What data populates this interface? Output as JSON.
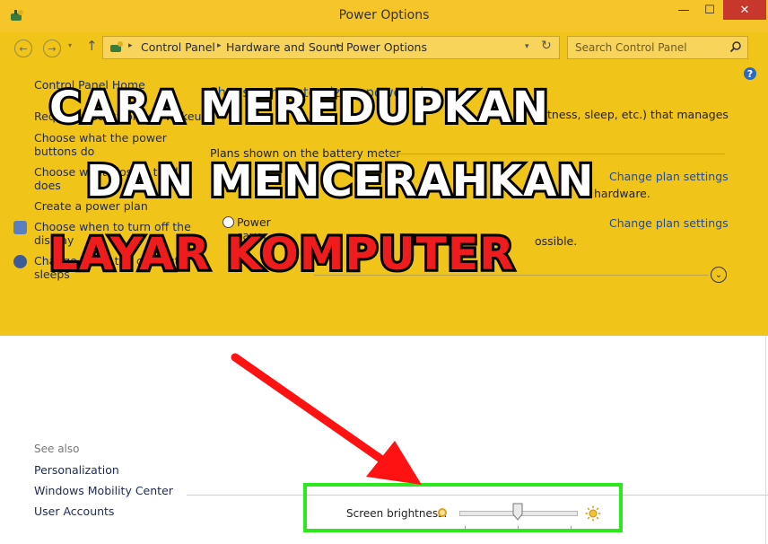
{
  "window": {
    "title": "Power Options",
    "controls": {
      "minimize": "—",
      "maximize": "☐",
      "close": "✕"
    }
  },
  "toolbar": {
    "back_glyph": "←",
    "forward_glyph": "→",
    "recent_glyph": "▾",
    "up_glyph": "↑",
    "breadcrumbs": [
      "Control Panel",
      "Hardware and Sound",
      "Power Options"
    ],
    "separator": "▸",
    "dropdown_glyph": "▾",
    "refresh_glyph": "↻",
    "search_placeholder": "Search Control Panel",
    "help_glyph": "?"
  },
  "sidebar": {
    "items": [
      {
        "label": "Control Panel Home"
      },
      {
        "label": "Require a password on wakeup"
      },
      {
        "label": "Choose what the power"
      },
      {
        "label": "buttons do"
      },
      {
        "label": "Choose what closing the lid"
      },
      {
        "label": "does"
      },
      {
        "label": "Create a power plan"
      },
      {
        "label": "Choose when to turn off the"
      },
      {
        "label": "display"
      },
      {
        "label": "Change when the computer"
      },
      {
        "label": "sleeps"
      }
    ],
    "see_also": "See also",
    "see_also_links": [
      "Personalization",
      "Windows Mobility Center",
      "User Accounts"
    ]
  },
  "main": {
    "title": "Choose or customize a power plan",
    "description": "tness, sleep, etc.) that manages",
    "plans_header": "Plans shown on the battery meter",
    "plans": [
      {
        "change_link": "Change plan settings",
        "description": "hardware."
      },
      {
        "name": "Power saver",
        "change_link": "Change plan settings",
        "description": "ossible."
      }
    ],
    "expander_glyph": "⌄"
  },
  "brightness": {
    "label": "Screen brightness:",
    "level": 0.5
  },
  "overlay": {
    "line1": "CARA MEREDUPKAN",
    "line2": "DAN MENCERAHKAN",
    "line3": "LAYAR KOMPUTER",
    "text_color": "#ffffff",
    "highlight_color": "#ee1c1c",
    "arrow_color": "#ff1212",
    "box_color": "#2ee81f"
  }
}
